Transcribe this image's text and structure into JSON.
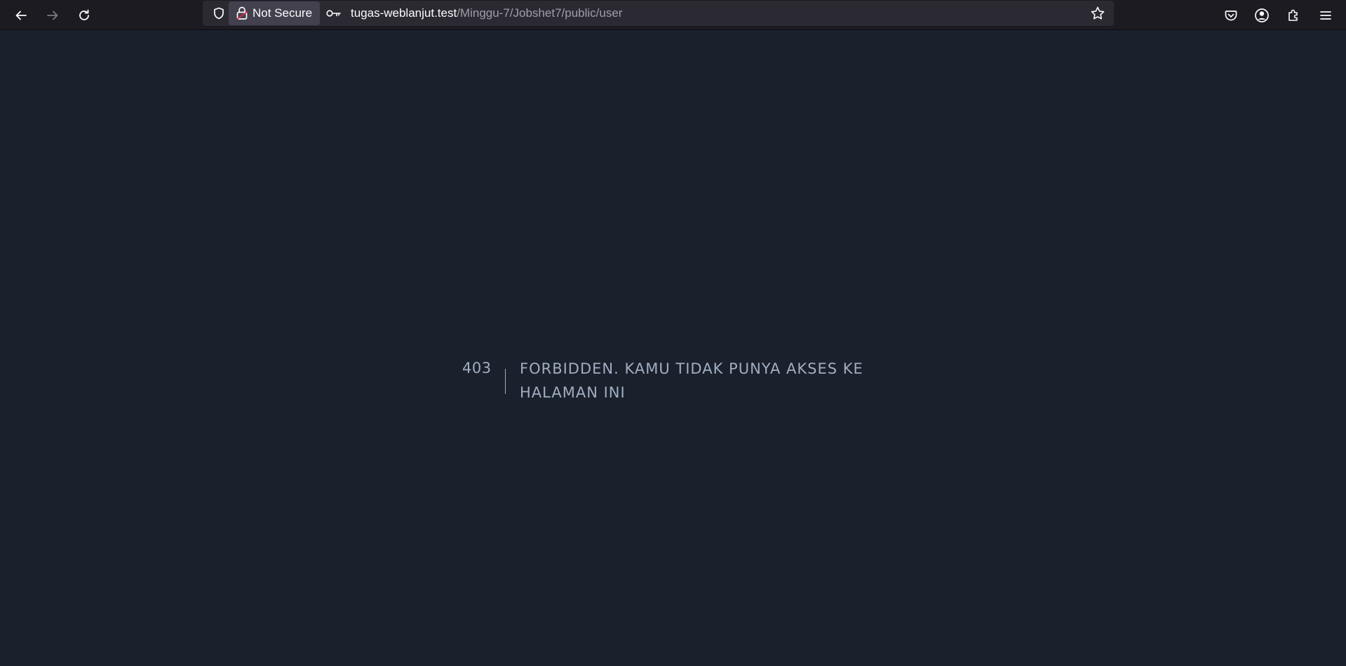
{
  "browser": {
    "toolbar": {
      "back_icon": "arrow-left-icon",
      "forward_icon": "arrow-right-icon",
      "reload_icon": "reload-icon"
    },
    "urlbar": {
      "security_label": "Not Secure",
      "url_host": "tugas-weblanjut.test",
      "url_path": "/Minggu-7/Jobshet7/public/user",
      "icons": [
        "shield-icon",
        "broken-lock-icon",
        "key-icon",
        "star-icon"
      ]
    },
    "right_icons": [
      "pocket-icon",
      "account-icon",
      "extensions-icon",
      "menu-icon"
    ]
  },
  "page": {
    "error_code": "403",
    "error_message": "Forbidden. Kamu tidak punya akses ke halaman ini"
  },
  "colors": {
    "toolbar_bg": "#1c1b22",
    "urlbar_bg": "#2b2a33",
    "page_bg": "#1a202c",
    "error_text": "#a0aec0",
    "lock_accent": "#e22850"
  }
}
